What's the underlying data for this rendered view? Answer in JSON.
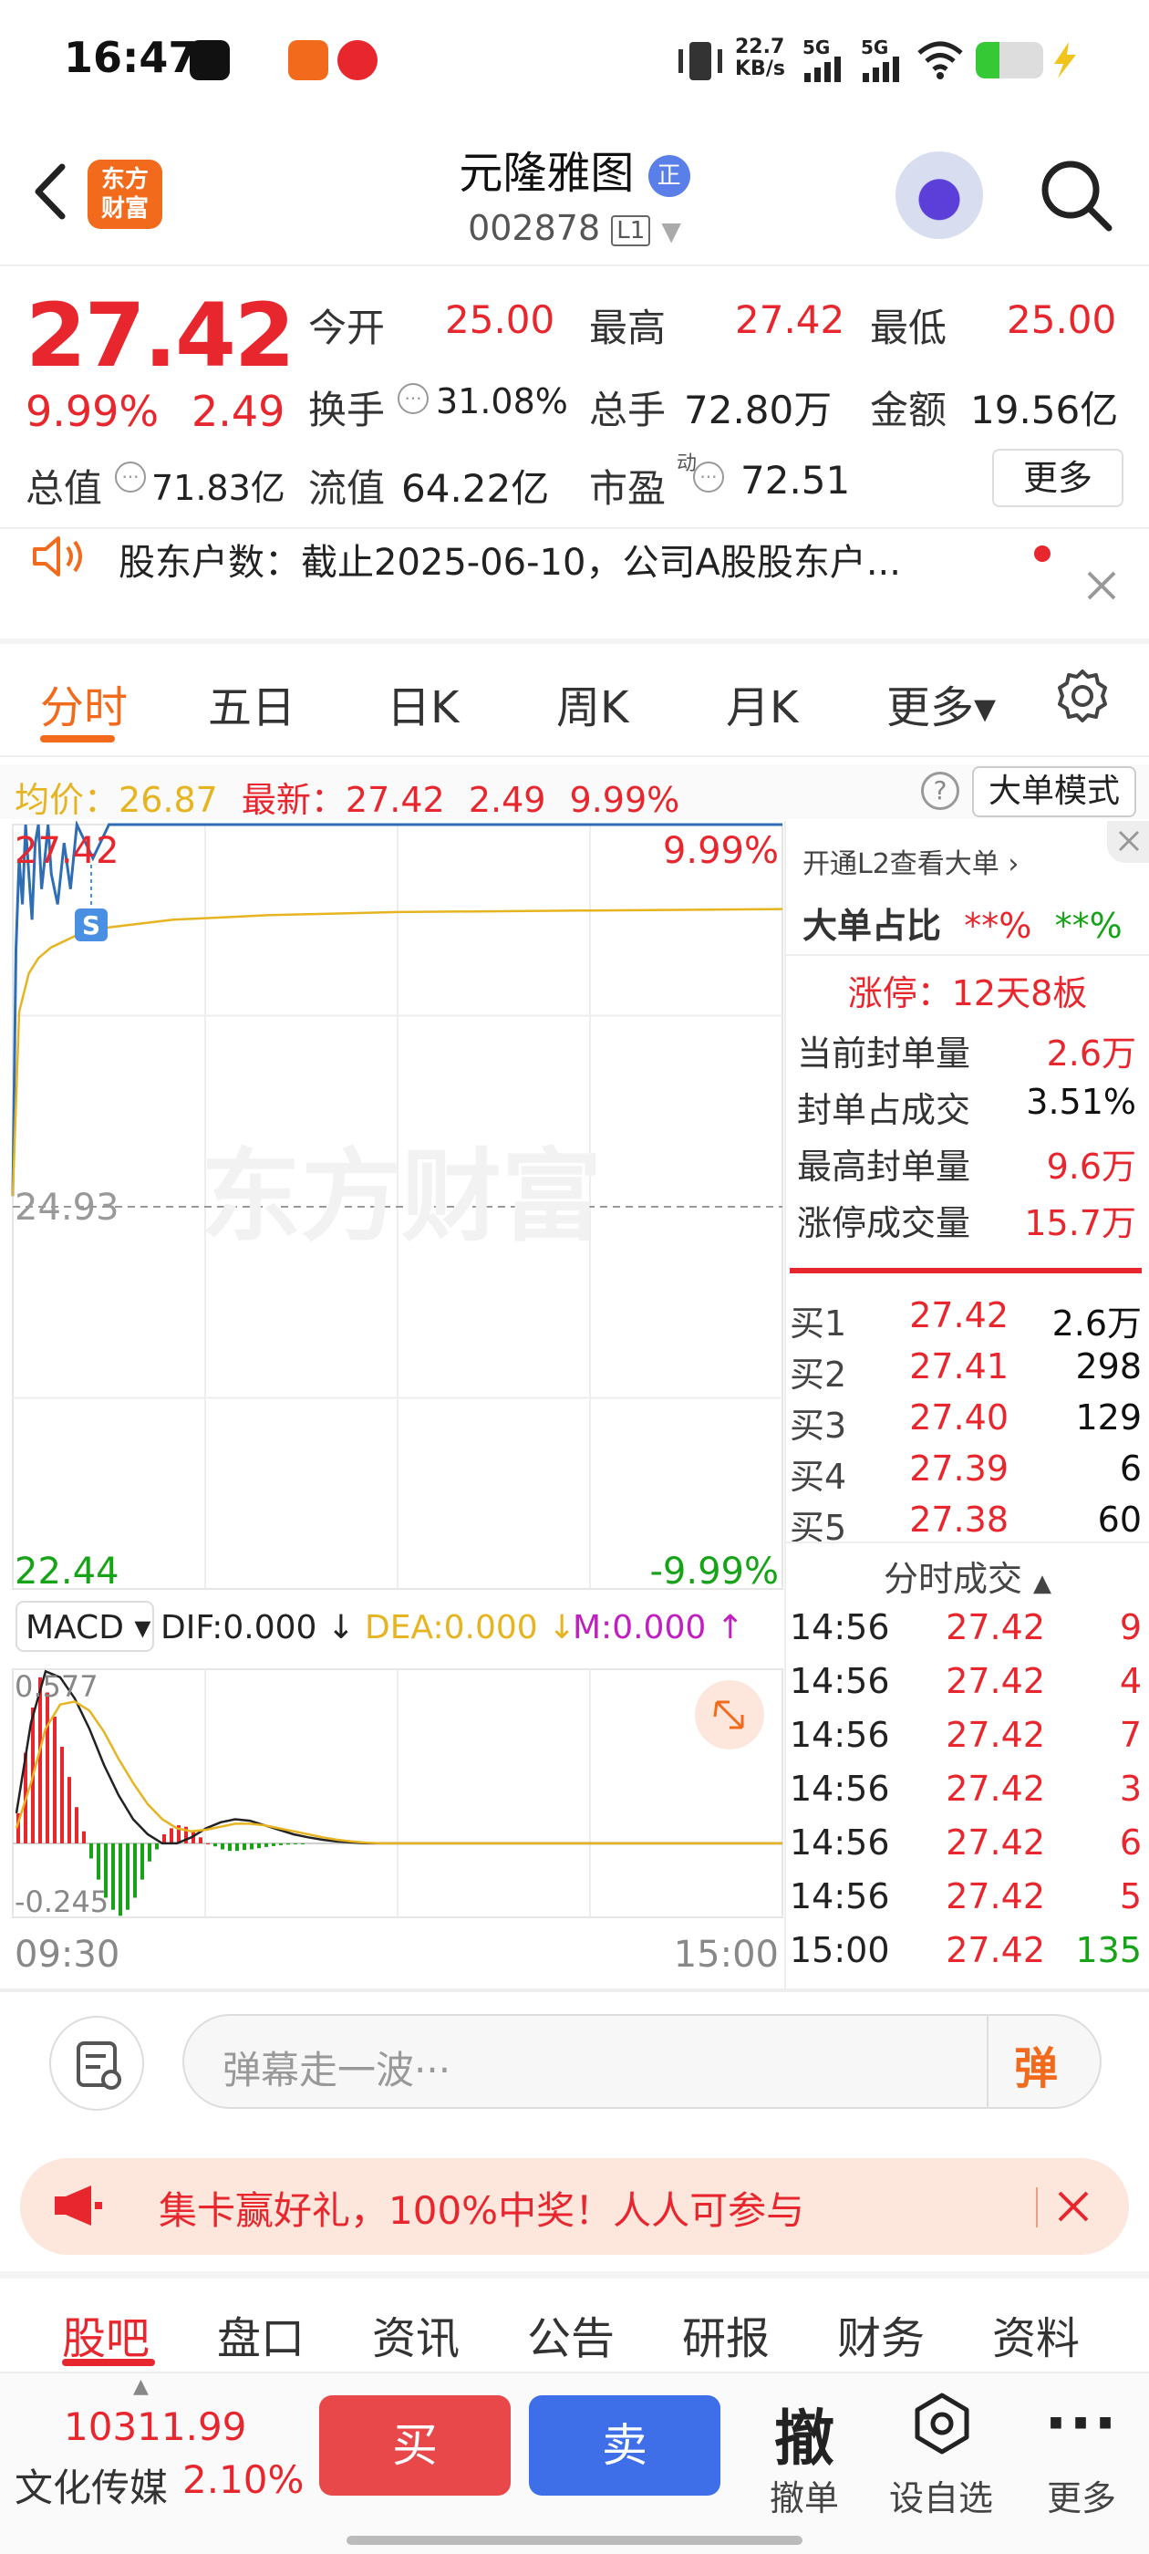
{
  "status_bar": {
    "time": "16:47",
    "net_speed": "22.7\nKB/s",
    "net_speed_top": "22.7",
    "net_speed_bottom": "KB/s",
    "signal1": "5G",
    "signal2": "5G"
  },
  "header": {
    "logo_line1": "东方",
    "logo_line2": "财富",
    "stock_name": "元隆雅图",
    "name_badge": "正",
    "stock_code": "002878",
    "level_badge": "L1"
  },
  "quote": {
    "price": "27.42",
    "change_pct": "9.99%",
    "change_val": "2.49",
    "open_label": "今开",
    "open": "25.00",
    "high_label": "最高",
    "high": "27.42",
    "low_label": "最低",
    "low": "25.00",
    "turnover_label": "换手",
    "turnover": "31.08%",
    "volume_label": "总手",
    "volume": "72.80万",
    "amount_label": "金额",
    "amount": "19.56亿",
    "mktcap_label": "总值",
    "mktcap": "71.83亿",
    "float_label": "流值",
    "float": "64.22亿",
    "pe_label": "市盈",
    "pe_sup": "动",
    "pe": "72.51",
    "more_label": "更多"
  },
  "news": {
    "text": "股东户数：截止2025-06-10，公司A股股东户..."
  },
  "chart_tabs": [
    {
      "label": "分时",
      "active": true
    },
    {
      "label": "五日",
      "active": false
    },
    {
      "label": "日K",
      "active": false
    },
    {
      "label": "周K",
      "active": false
    },
    {
      "label": "月K",
      "active": false
    },
    {
      "label": "更多▾",
      "active": false
    }
  ],
  "avg_bar": {
    "avg_label": "均价：",
    "avg_value": "26.87",
    "latest_label": "最新：",
    "latest_value": "27.42",
    "latest_change": "2.49",
    "latest_pct": "9.99%",
    "help": "?",
    "mode_button": "大单模式"
  },
  "chart_data": {
    "type": "line",
    "x_start": "09:30",
    "x_end": "15:00",
    "ylim": [
      22.44,
      27.42
    ],
    "y_top_label": "27.42",
    "y_mid_label": "24.93",
    "y_bottom_label": "22.44",
    "pct_top_label": "9.99%",
    "pct_bottom_label": "-9.99%",
    "watermark": "东方财富",
    "s_marker": "S",
    "series": [
      {
        "color": "#2f6db5",
        "x": [
          0,
          1,
          2,
          3,
          4,
          5,
          6,
          7,
          8,
          9,
          10,
          11,
          12,
          14,
          16,
          18,
          20,
          25,
          30,
          35,
          40,
          45,
          50,
          60,
          80,
          120,
          180,
          240
        ],
        "y": [
          25.0,
          26.6,
          27.2,
          26.9,
          27.42,
          27.1,
          26.8,
          27.3,
          27.42,
          27.0,
          27.2,
          27.42,
          27.1,
          26.9,
          27.3,
          27.0,
          27.42,
          27.2,
          27.42,
          27.42,
          27.42,
          27.42,
          27.42,
          27.42,
          27.42,
          27.42,
          27.42,
          27.42
        ]
      },
      {
        "color": "#e6b421",
        "x": [
          0,
          2,
          5,
          8,
          12,
          20,
          30,
          50,
          80,
          120,
          180,
          240
        ],
        "y": [
          25.0,
          26.2,
          26.45,
          26.55,
          26.62,
          26.7,
          26.75,
          26.8,
          26.83,
          26.85,
          26.86,
          26.87
        ]
      }
    ],
    "macd": {
      "indicator": "MACD",
      "dif_label": "DIF:0.000",
      "dea_label": "DEA:0.000",
      "m_label": "M:0.000",
      "top_label": "0.577",
      "bottom_label": "-0.245",
      "ylim": [
        -0.245,
        0.577
      ],
      "bars": [
        0.1,
        0.3,
        0.45,
        0.55,
        0.5,
        0.42,
        0.32,
        0.22,
        0.12,
        0.04,
        -0.05,
        -0.12,
        -0.18,
        -0.22,
        -0.24,
        -0.22,
        -0.18,
        -0.12,
        -0.06,
        -0.02,
        0.03,
        0.05,
        0.06,
        0.055,
        0.04,
        0.02,
        0.0,
        -0.01,
        -0.02,
        -0.025,
        -0.025,
        -0.022,
        -0.02,
        -0.016,
        -0.012,
        -0.009,
        -0.006,
        -0.004,
        -0.002,
        -0.001
      ],
      "dif": [
        0.1,
        0.4,
        0.57,
        0.55,
        0.48,
        0.38,
        0.26,
        0.16,
        0.08,
        0.03,
        0.0,
        0.0,
        0.02,
        0.05,
        0.07,
        0.08,
        0.075,
        0.06,
        0.045,
        0.03,
        0.02,
        0.012,
        0.006,
        0.003,
        0.0,
        0.0
      ],
      "dea": [
        0.05,
        0.2,
        0.38,
        0.46,
        0.47,
        0.44,
        0.37,
        0.28,
        0.2,
        0.13,
        0.08,
        0.05,
        0.04,
        0.045,
        0.055,
        0.065,
        0.065,
        0.06,
        0.05,
        0.04,
        0.03,
        0.02,
        0.012,
        0.006,
        0.002,
        0.0
      ]
    }
  },
  "right_panel": {
    "banner": "开通L2查看大单 ›",
    "ratio_label": "大单占比",
    "ratio_red": "**%",
    "ratio_green": "**%",
    "limit_title": "涨停：12天8板",
    "seal_rows": [
      {
        "label": "当前封单量",
        "value": "2.6万",
        "red": true
      },
      {
        "label": "封单占成交",
        "value": "3.51%",
        "red": false
      },
      {
        "label": "最高封单量",
        "value": "9.6万",
        "red": true
      },
      {
        "label": "涨停成交量",
        "value": "15.7万",
        "red": true
      }
    ],
    "bids": [
      {
        "label": "买1",
        "price": "27.42",
        "vol": "2.6万"
      },
      {
        "label": "买2",
        "price": "27.41",
        "vol": "298"
      },
      {
        "label": "买3",
        "price": "27.40",
        "vol": "129"
      },
      {
        "label": "买4",
        "price": "27.39",
        "vol": "6"
      },
      {
        "label": "买5",
        "price": "27.38",
        "vol": "60"
      }
    ],
    "ticks_title": "分时成交",
    "ticks": [
      {
        "time": "14:56",
        "price": "27.42",
        "vol": "9",
        "color": "red"
      },
      {
        "time": "14:56",
        "price": "27.42",
        "vol": "4",
        "color": "red"
      },
      {
        "time": "14:56",
        "price": "27.42",
        "vol": "7",
        "color": "red"
      },
      {
        "time": "14:56",
        "price": "27.42",
        "vol": "3",
        "color": "red"
      },
      {
        "time": "14:56",
        "price": "27.42",
        "vol": "6",
        "color": "red"
      },
      {
        "time": "14:56",
        "price": "27.42",
        "vol": "5",
        "color": "red"
      },
      {
        "time": "15:00",
        "price": "27.42",
        "vol": "135",
        "color": "green"
      }
    ]
  },
  "comment": {
    "placeholder": "弹幕走一波···",
    "danmu_label": "弹"
  },
  "promo": {
    "text": "集卡赢好礼，100%中奖！人人可参与"
  },
  "bottom_tabs": [
    {
      "label": "股吧",
      "active": true
    },
    {
      "label": "盘口",
      "active": false
    },
    {
      "label": "资讯",
      "active": false
    },
    {
      "label": "公告",
      "active": false
    },
    {
      "label": "研报",
      "active": false
    },
    {
      "label": "财务",
      "active": false
    },
    {
      "label": "资料",
      "active": false
    }
  ],
  "footer": {
    "index_value": "10311.99",
    "index_name": "文化传媒",
    "index_pct": "2.10%",
    "buy": "买",
    "sell": "卖",
    "cancel_icon": "撤",
    "cancel_label": "撤单",
    "watch_label": "设自选",
    "more_icon": "···",
    "more_label": "更多"
  },
  "colors": {
    "up": "#e8262d",
    "down": "#17a317",
    "accent": "#f26b1d",
    "price_line": "#2f6db5",
    "avg_line": "#e6b421"
  }
}
